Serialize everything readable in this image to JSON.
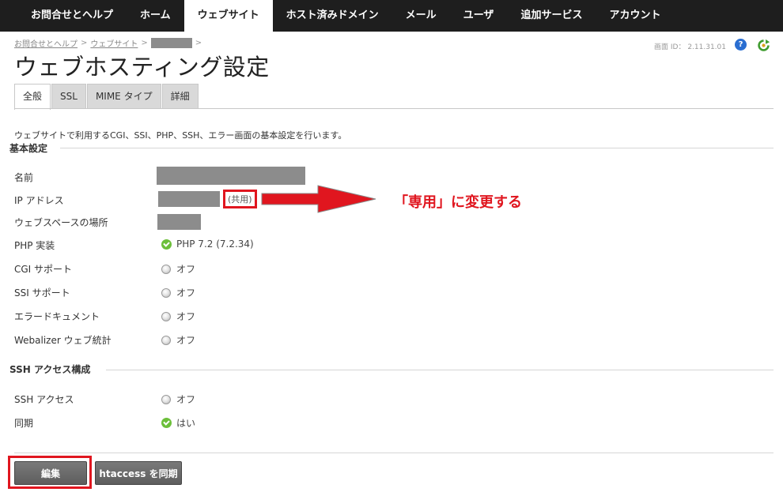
{
  "nav": {
    "items": [
      {
        "label": "お問合せとヘルプ",
        "active": false
      },
      {
        "label": "ホーム",
        "active": false
      },
      {
        "label": "ウェブサイト",
        "active": true
      },
      {
        "label": "ホスト済みドメイン",
        "active": false
      },
      {
        "label": "メール",
        "active": false
      },
      {
        "label": "ユーザ",
        "active": false
      },
      {
        "label": "追加サービス",
        "active": false
      },
      {
        "label": "アカウント",
        "active": false
      }
    ]
  },
  "breadcrumb": {
    "items": [
      "お問合せとヘルプ",
      "ウェブサイト"
    ],
    "separator": ">"
  },
  "screen_id": "画面 ID： 2.11.31.01",
  "help": {
    "glyph": "?"
  },
  "page_title": "ウェブホスティング設定",
  "tabs": [
    {
      "label": "全般",
      "active": true
    },
    {
      "label": "SSL",
      "active": false
    },
    {
      "label": "MIME タイプ",
      "active": false
    },
    {
      "label": "詳細",
      "active": false
    }
  ],
  "description": "ウェブサイトで利用するCGI、SSI、PHP、SSH、エラー画面の基本設定を行います。",
  "basic_settings": {
    "heading": "基本設定",
    "name_label": "名前",
    "ip_label": "IP アドレス",
    "ip_shared": "(共用)",
    "webspace_label": "ウェブスペースの場所",
    "php_label": "PHP 実装",
    "php_value": "PHP 7.2 (7.2.34)",
    "cgi_label": "CGI サポート",
    "cgi_value": "オフ",
    "ssi_label": "SSI サポート",
    "ssi_value": "オフ",
    "errdoc_label": "エラードキュメント",
    "errdoc_value": "オフ",
    "webalizer_label": "Webalizer ウェブ統計",
    "webalizer_value": "オフ"
  },
  "ssh_settings": {
    "heading": "SSH アクセス構成",
    "ssh_label": "SSH アクセス",
    "ssh_value": "オフ",
    "sync_label": "同期",
    "sync_value": "はい"
  },
  "annotation": "「専用」に変更する",
  "buttons": {
    "edit": "編集",
    "sync_htaccess": "htaccess を同期"
  },
  "colors": {
    "accent_red": "#e0161f",
    "nav_bg": "#1e1e1e",
    "status_on": "#6cbf3a",
    "help_blue": "#2a6ed1",
    "refresh_green": "#3e9b2e"
  }
}
